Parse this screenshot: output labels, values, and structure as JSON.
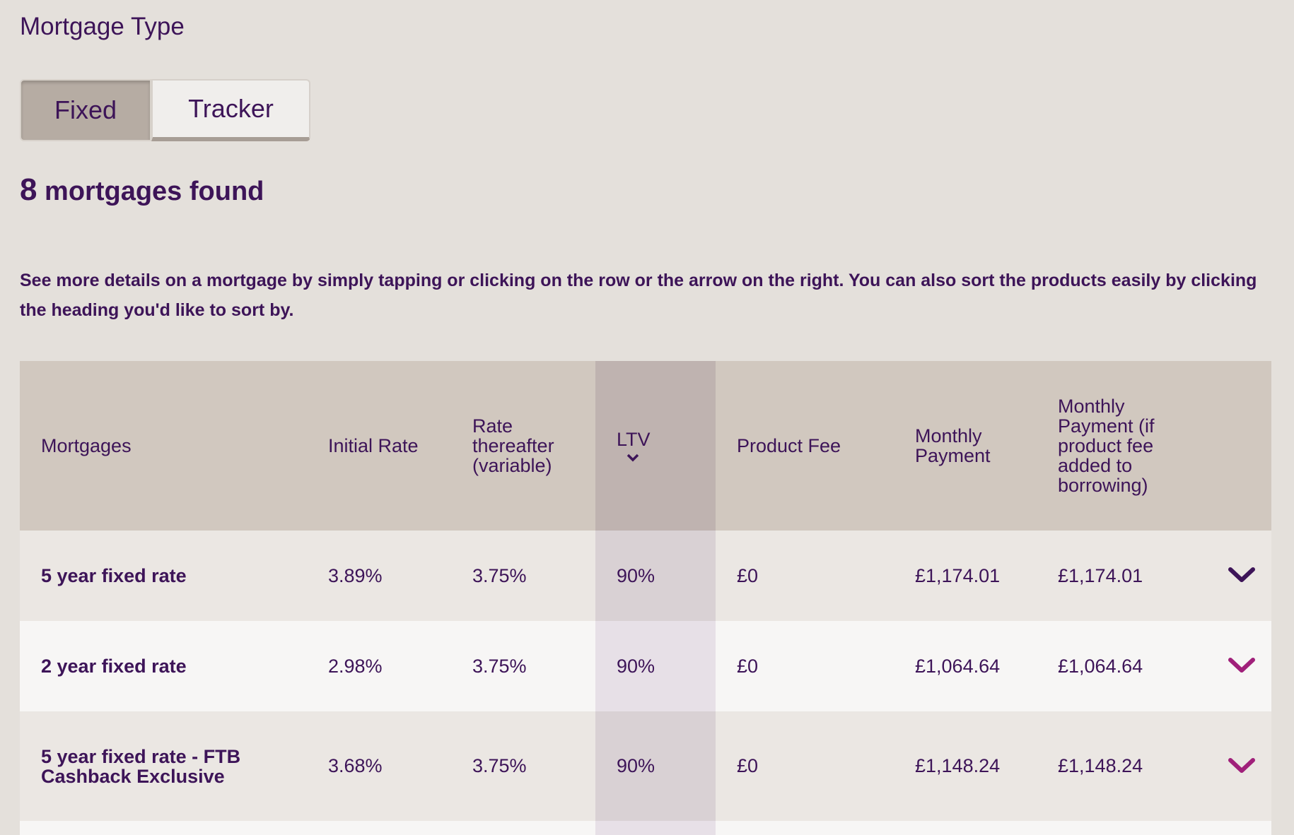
{
  "section_title": "Mortgage Type",
  "toggle": {
    "fixed_label": "Fixed",
    "tracker_label": "Tracker",
    "selected": "Fixed"
  },
  "results": {
    "count": "8",
    "label": "mortgages found"
  },
  "intro_text": "See more details on a mortgage by simply tapping or clicking on the row or the arrow on the right. You can also sort the products easily by clicking the heading you'd like to sort by.",
  "table": {
    "headers": {
      "mortgages": "Mortgages",
      "initial_rate": "Initial Rate",
      "rate_thereafter": "Rate thereafter (variable)",
      "ltv": "LTV",
      "product_fee": "Product Fee",
      "monthly_payment": "Monthly Payment",
      "monthly_payment_fee": "Monthly Payment (if product fee added to borrowing)"
    },
    "sorted_by": "LTV",
    "rows": [
      {
        "name": "5 year fixed rate",
        "initial_rate": "3.89%",
        "rate_thereafter": "3.75%",
        "ltv": "90%",
        "product_fee": "£0",
        "monthly_payment": "£1,174.01",
        "monthly_payment_fee": "£1,174.01"
      },
      {
        "name": "2 year fixed rate",
        "initial_rate": "2.98%",
        "rate_thereafter": "3.75%",
        "ltv": "90%",
        "product_fee": "£0",
        "monthly_payment": "£1,064.64",
        "monthly_payment_fee": "£1,064.64"
      },
      {
        "name": "5 year fixed rate - FTB Cashback Exclusive",
        "initial_rate": "3.68%",
        "rate_thereafter": "3.75%",
        "ltv": "90%",
        "product_fee": "£0",
        "monthly_payment": "£1,148.24",
        "monthly_payment_fee": "£1,148.24"
      }
    ]
  },
  "colors": {
    "text": "#3d1458",
    "page_bg": "#e4e0db",
    "header_bg": "#d1c8bf",
    "sorted_header_bg": "#bfb3b0",
    "chevron_dark": "#3d1458",
    "chevron_accent": "#a0207a"
  },
  "icons": {
    "sort_indicator": "chevron-down-icon",
    "row_expand": "chevron-down-icon"
  }
}
